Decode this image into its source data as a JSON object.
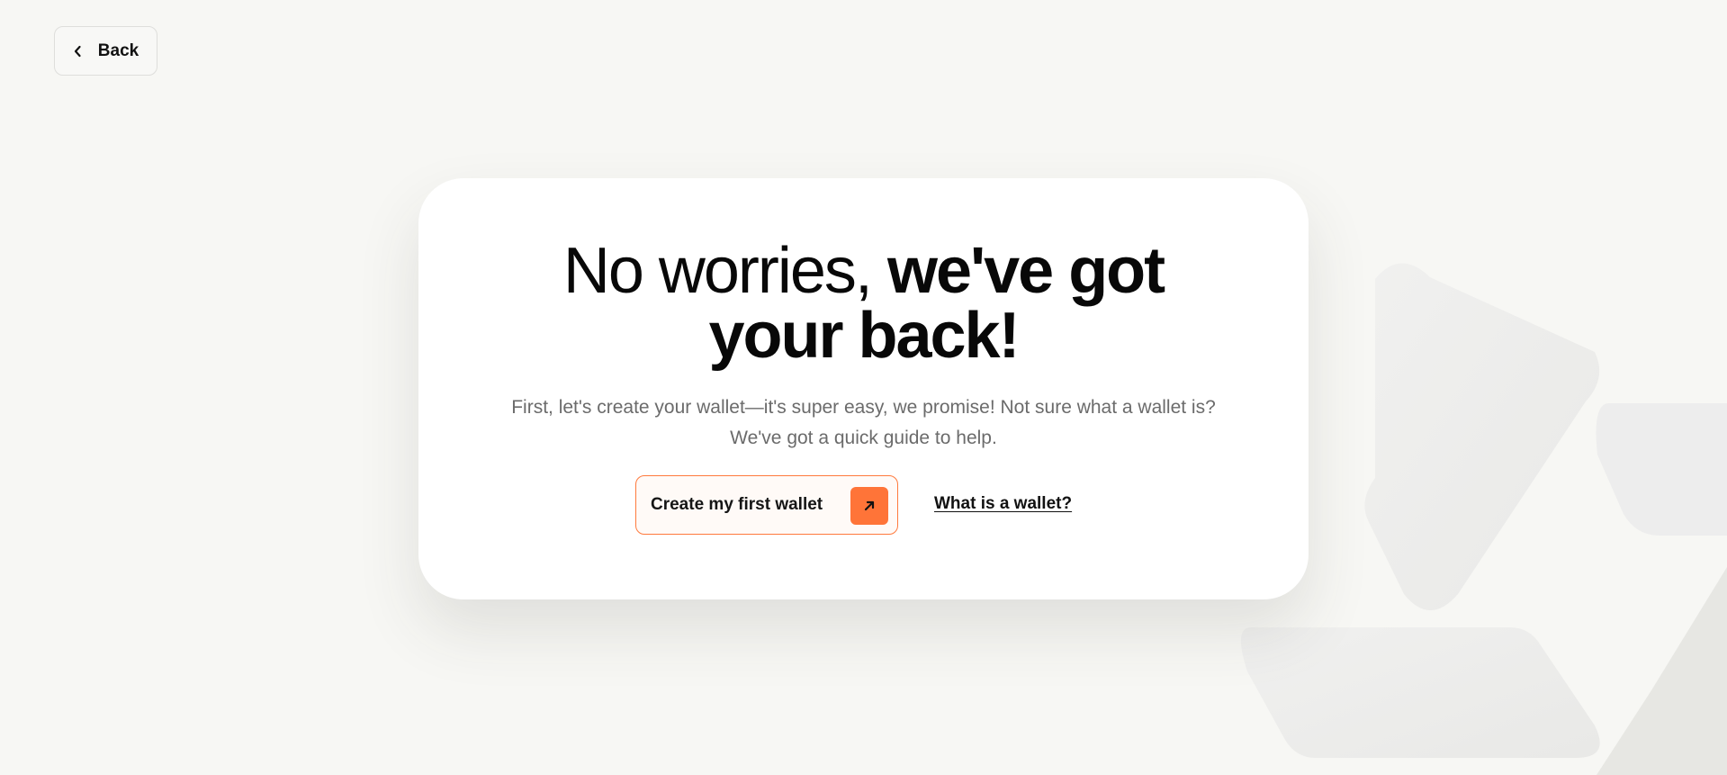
{
  "navigation": {
    "back_label": "Back",
    "back_icon": "chevron-left-icon"
  },
  "card": {
    "headline_regular": "No worries, ",
    "headline_bold_line1": "we've got",
    "headline_bold_line2": "your back!",
    "subtitle_line1": "First, let's create your wallet—it's super easy, we promise! Not sure what a wallet is?",
    "subtitle_line2": "We've got a quick guide to help."
  },
  "actions": {
    "create_wallet_label": "Create my first wallet",
    "create_wallet_icon": "arrow-up-right-icon",
    "what_is_wallet_label": "What is a wallet?"
  },
  "colors": {
    "background": "#f7f7f4",
    "card_background": "#ffffff",
    "accent_orange": "#ff7438",
    "primary_text": "#080808",
    "secondary_text": "#6b6b6b",
    "decorative_shapes": "#ebebea"
  }
}
